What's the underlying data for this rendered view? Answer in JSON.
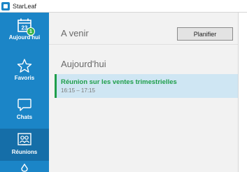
{
  "app": {
    "title": "StarLeaf"
  },
  "sidebar": {
    "items": [
      {
        "label": "Aujourd'hui",
        "icon": "calendar-icon",
        "calendar_number": "23",
        "badge": "1"
      },
      {
        "label": "Favoris",
        "icon": "star-icon"
      },
      {
        "label": "Chats",
        "icon": "chat-bubble-icon"
      },
      {
        "label": "Réunions",
        "icon": "meetings-icon",
        "active": true
      },
      {
        "label": "",
        "icon": "more-icon"
      }
    ]
  },
  "header": {
    "title": "A venir",
    "plan_button": "Planifier"
  },
  "today": {
    "title": "Aujourd'hui",
    "meetings": [
      {
        "title": "Réunion sur les ventes trimestrielles",
        "time": "16:15 – 17:15"
      }
    ]
  },
  "colors": {
    "brand_blue": "#1b85c7",
    "active_blue": "#156ea8",
    "accent_green": "#1e9e4a",
    "selected_row": "#cfe6f3"
  }
}
